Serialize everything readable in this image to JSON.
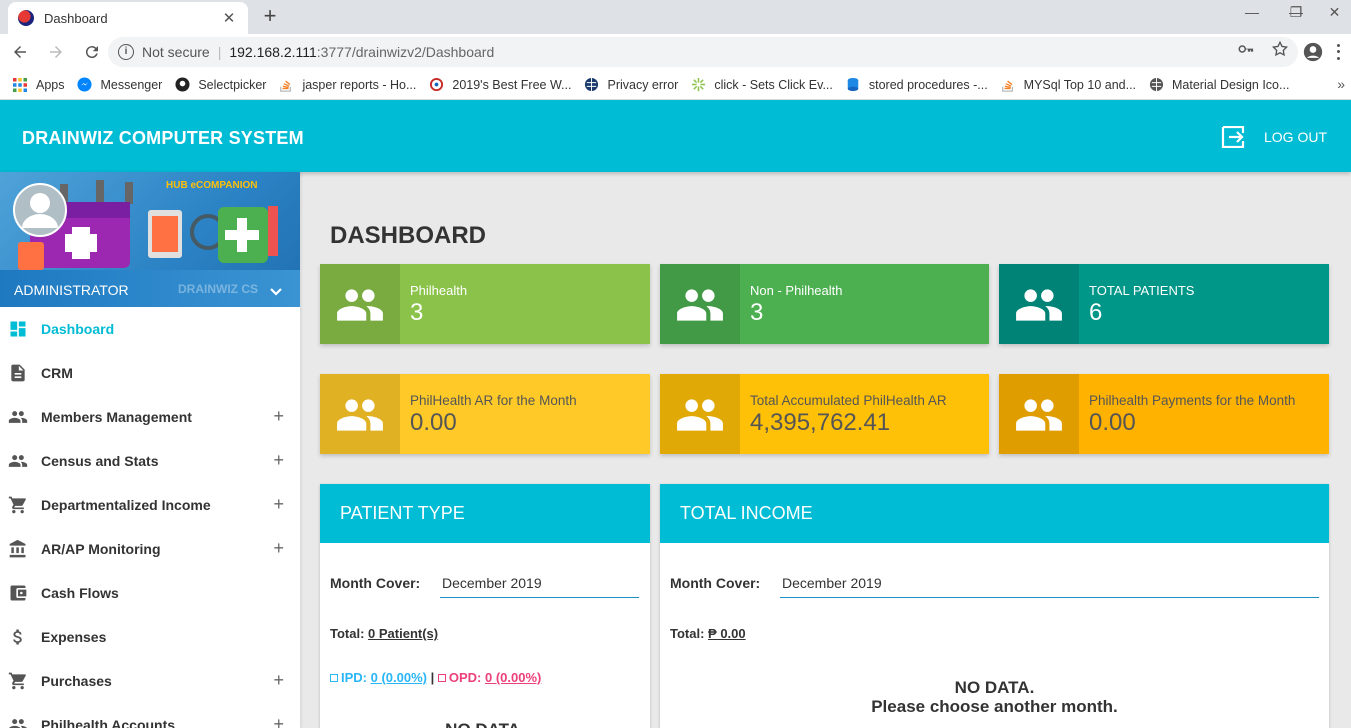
{
  "browser": {
    "tab_title": "Dashboard",
    "tab_close": "✕",
    "new_tab": "+",
    "window_controls": [
      "—",
      "❐",
      "✕"
    ],
    "security_label": "Not secure",
    "url_host": "192.168.2.111",
    "url_path": ":3777/drainwizv2/Dashboard",
    "bookmarks": [
      {
        "label": "Apps",
        "icon": "apps-grid-icon"
      },
      {
        "label": "Messenger",
        "icon": "messenger-icon"
      },
      {
        "label": "Selectpicker",
        "icon": "github-icon"
      },
      {
        "label": "jasper reports - Ho...",
        "icon": "stackoverflow-icon"
      },
      {
        "label": "2019's Best Free W...",
        "icon": "site-icon"
      },
      {
        "label": "Privacy error",
        "icon": "globe-icon"
      },
      {
        "label": "click - Sets Click Ev...",
        "icon": "sparkle-icon"
      },
      {
        "label": "stored procedures -...",
        "icon": "database-icon"
      },
      {
        "label": "MYSql Top 10 and...",
        "icon": "stackoverflow-icon"
      },
      {
        "label": "Material Design Ico...",
        "icon": "globe-icon"
      }
    ],
    "bookmarks_more": "»"
  },
  "header": {
    "brand": "DRAINWIZ COMPUTER SYSTEM",
    "logout_label": "LOG OUT"
  },
  "sidebar": {
    "banner_text": "HUB eCOMPANION",
    "user_role": "ADMINISTRATOR",
    "user_faint": "DRAINWIZ CS",
    "items": [
      {
        "label": "Dashboard",
        "icon": "dashboard-icon",
        "active": true,
        "expandable": false
      },
      {
        "label": "CRM",
        "icon": "document-icon",
        "active": false,
        "expandable": false
      },
      {
        "label": "Members Management",
        "icon": "people-icon",
        "active": false,
        "expandable": true
      },
      {
        "label": "Census and Stats",
        "icon": "people-icon",
        "active": false,
        "expandable": true
      },
      {
        "label": "Departmentalized Income",
        "icon": "cart-icon",
        "active": false,
        "expandable": true
      },
      {
        "label": "AR/AP Monitoring",
        "icon": "bank-icon",
        "active": false,
        "expandable": true
      },
      {
        "label": "Cash Flows",
        "icon": "wallet-icon",
        "active": false,
        "expandable": false
      },
      {
        "label": "Expenses",
        "icon": "dollar-icon",
        "active": false,
        "expandable": false
      },
      {
        "label": "Purchases",
        "icon": "cart-icon",
        "active": false,
        "expandable": true
      },
      {
        "label": "Philhealth Accounts",
        "icon": "people-icon",
        "active": false,
        "expandable": true
      }
    ],
    "plus": "+"
  },
  "main": {
    "title": "DASHBOARD",
    "info_boxes": [
      {
        "label": "Philhealth",
        "value": "3",
        "color": "#8bc34a"
      },
      {
        "label": "Non - Philhealth",
        "value": "3",
        "color": "#4caf50"
      },
      {
        "label": "TOTAL PATIENTS",
        "value": "6",
        "color": "#009688"
      },
      {
        "label": "PhilHealth AR for the Month",
        "value": "0.00",
        "color": "#ffca28"
      },
      {
        "label": "Total Accumulated PhilHealth AR",
        "value": "4,395,762.41",
        "color": "#ffc107"
      },
      {
        "label": "Philhealth Payments for the Month",
        "value": "0.00",
        "color": "#ffb300"
      }
    ],
    "patient_type": {
      "title": "PATIENT TYPE",
      "month_label": "Month Cover:",
      "month_value": "December 2019",
      "total_label": "Total:",
      "total_value": "0 Patient(s)",
      "ipd_label": "IPD:",
      "ipd_value": "0 (0.00%)",
      "divider": "|",
      "opd_label": "OPD:",
      "opd_value": "0 (0.00%)",
      "nodata": "NO DATA."
    },
    "total_income": {
      "title": "TOTAL INCOME",
      "month_label": "Month Cover:",
      "month_value": "December 2019",
      "total_label": "Total:",
      "total_value": "₱ 0.00",
      "nodata_line1": "NO DATA.",
      "nodata_line2": "Please choose another month."
    }
  }
}
